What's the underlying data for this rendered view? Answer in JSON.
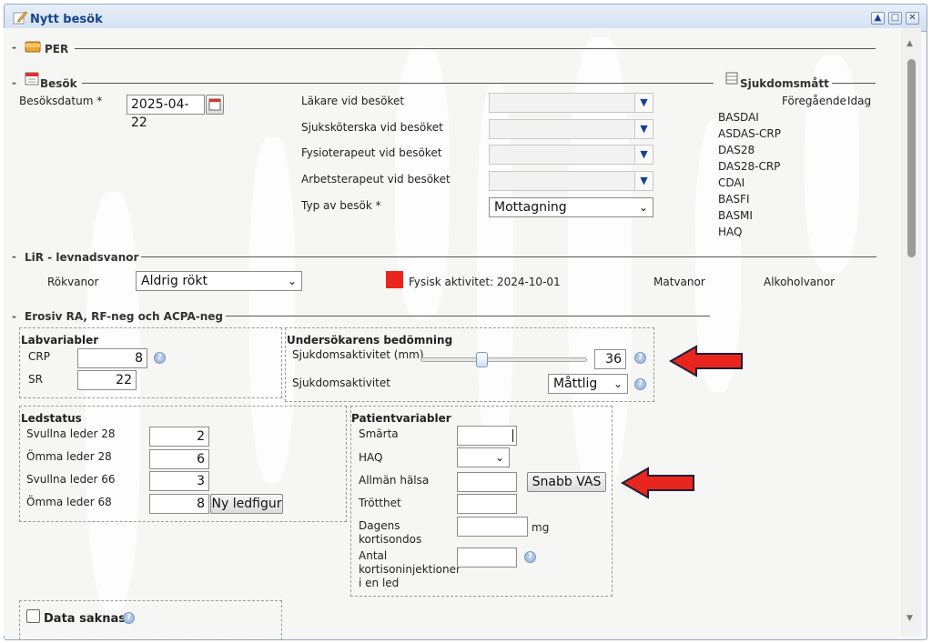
{
  "window": {
    "title": "Nytt besök",
    "controls": [
      "▲",
      "□",
      "✕"
    ]
  },
  "per": {
    "title": "PER"
  },
  "besok": {
    "title": "Besök",
    "date_label": "Besöksdatum *",
    "date_value": "2025-04-22",
    "fields": [
      {
        "label": "Läkare vid besöket",
        "value": ""
      },
      {
        "label": "Sjuksköterska vid besöket",
        "value": ""
      },
      {
        "label": "Fysioterapeut vid besöket",
        "value": ""
      },
      {
        "label": "Arbetsterapeut vid besöket",
        "value": ""
      }
    ],
    "typ_label": "Typ av besök  *",
    "typ_value": "Mottagning"
  },
  "sjukdomsmatt": {
    "title": "Sjukdomsmått",
    "col_prev": "Föregående",
    "col_today": "Idag",
    "items": [
      "BASDAI",
      "ASDAS-CRP",
      "DAS28",
      "DAS28-CRP",
      "CDAI",
      "BASFI",
      "BASMI",
      "HAQ"
    ]
  },
  "lir": {
    "title": "LiR - levnadsvanor",
    "rokvanor_label": "Rökvanor",
    "rokvanor_value": "Aldrig rökt",
    "fysisk_label": "Fysisk aktivitet: 2024-10-01",
    "fysisk_color": "#e8261d",
    "matvanor_label": "Matvanor",
    "alkohol_label": "Alkoholvanor"
  },
  "erosiv": {
    "title": "Erosiv RA, RF-neg och ACPA-neg"
  },
  "labvariabler": {
    "title": "Labvariabler",
    "crp_label": "CRP",
    "crp_value": "8",
    "sr_label": "SR",
    "sr_value": "22"
  },
  "undersokare": {
    "title": "Undersökarens bedömning",
    "slider_label": "Sjukdomsaktivitet (mm)",
    "slider_value": "36",
    "slider_level_mm": 36,
    "aktivitet_label": "Sjukdomsaktivitet",
    "aktivitet_value": "Måttlig"
  },
  "ledstatus": {
    "title": "Ledstatus",
    "rows": [
      {
        "label": "Svullna leder 28",
        "value": "2"
      },
      {
        "label": "Ömma leder 28",
        "value": "6"
      },
      {
        "label": "Svullna leder 66",
        "value": "3"
      },
      {
        "label": "Ömma leder 68",
        "value": "8"
      }
    ],
    "ny_ledfigur": "Ny ledfigur"
  },
  "patient": {
    "title": "Patientvariabler",
    "smarta_label": "Smärta",
    "haq_label": "HAQ",
    "allman_label": "Allmän hälsa",
    "snabb_vas": "Snabb VAS",
    "trotthet_label": "Trötthet",
    "kortison_label_1": "Dagens",
    "kortison_label_2": "kortisondos",
    "kortison_unit": "mg",
    "injektion_label_1": "Antal",
    "injektion_label_2": "kortisoninjektioner",
    "injektion_label_3": "i en led"
  },
  "data_saknas": {
    "label": "Data saknas"
  },
  "colors": {
    "accent": "#15428b",
    "arrow": "#e8261d"
  }
}
